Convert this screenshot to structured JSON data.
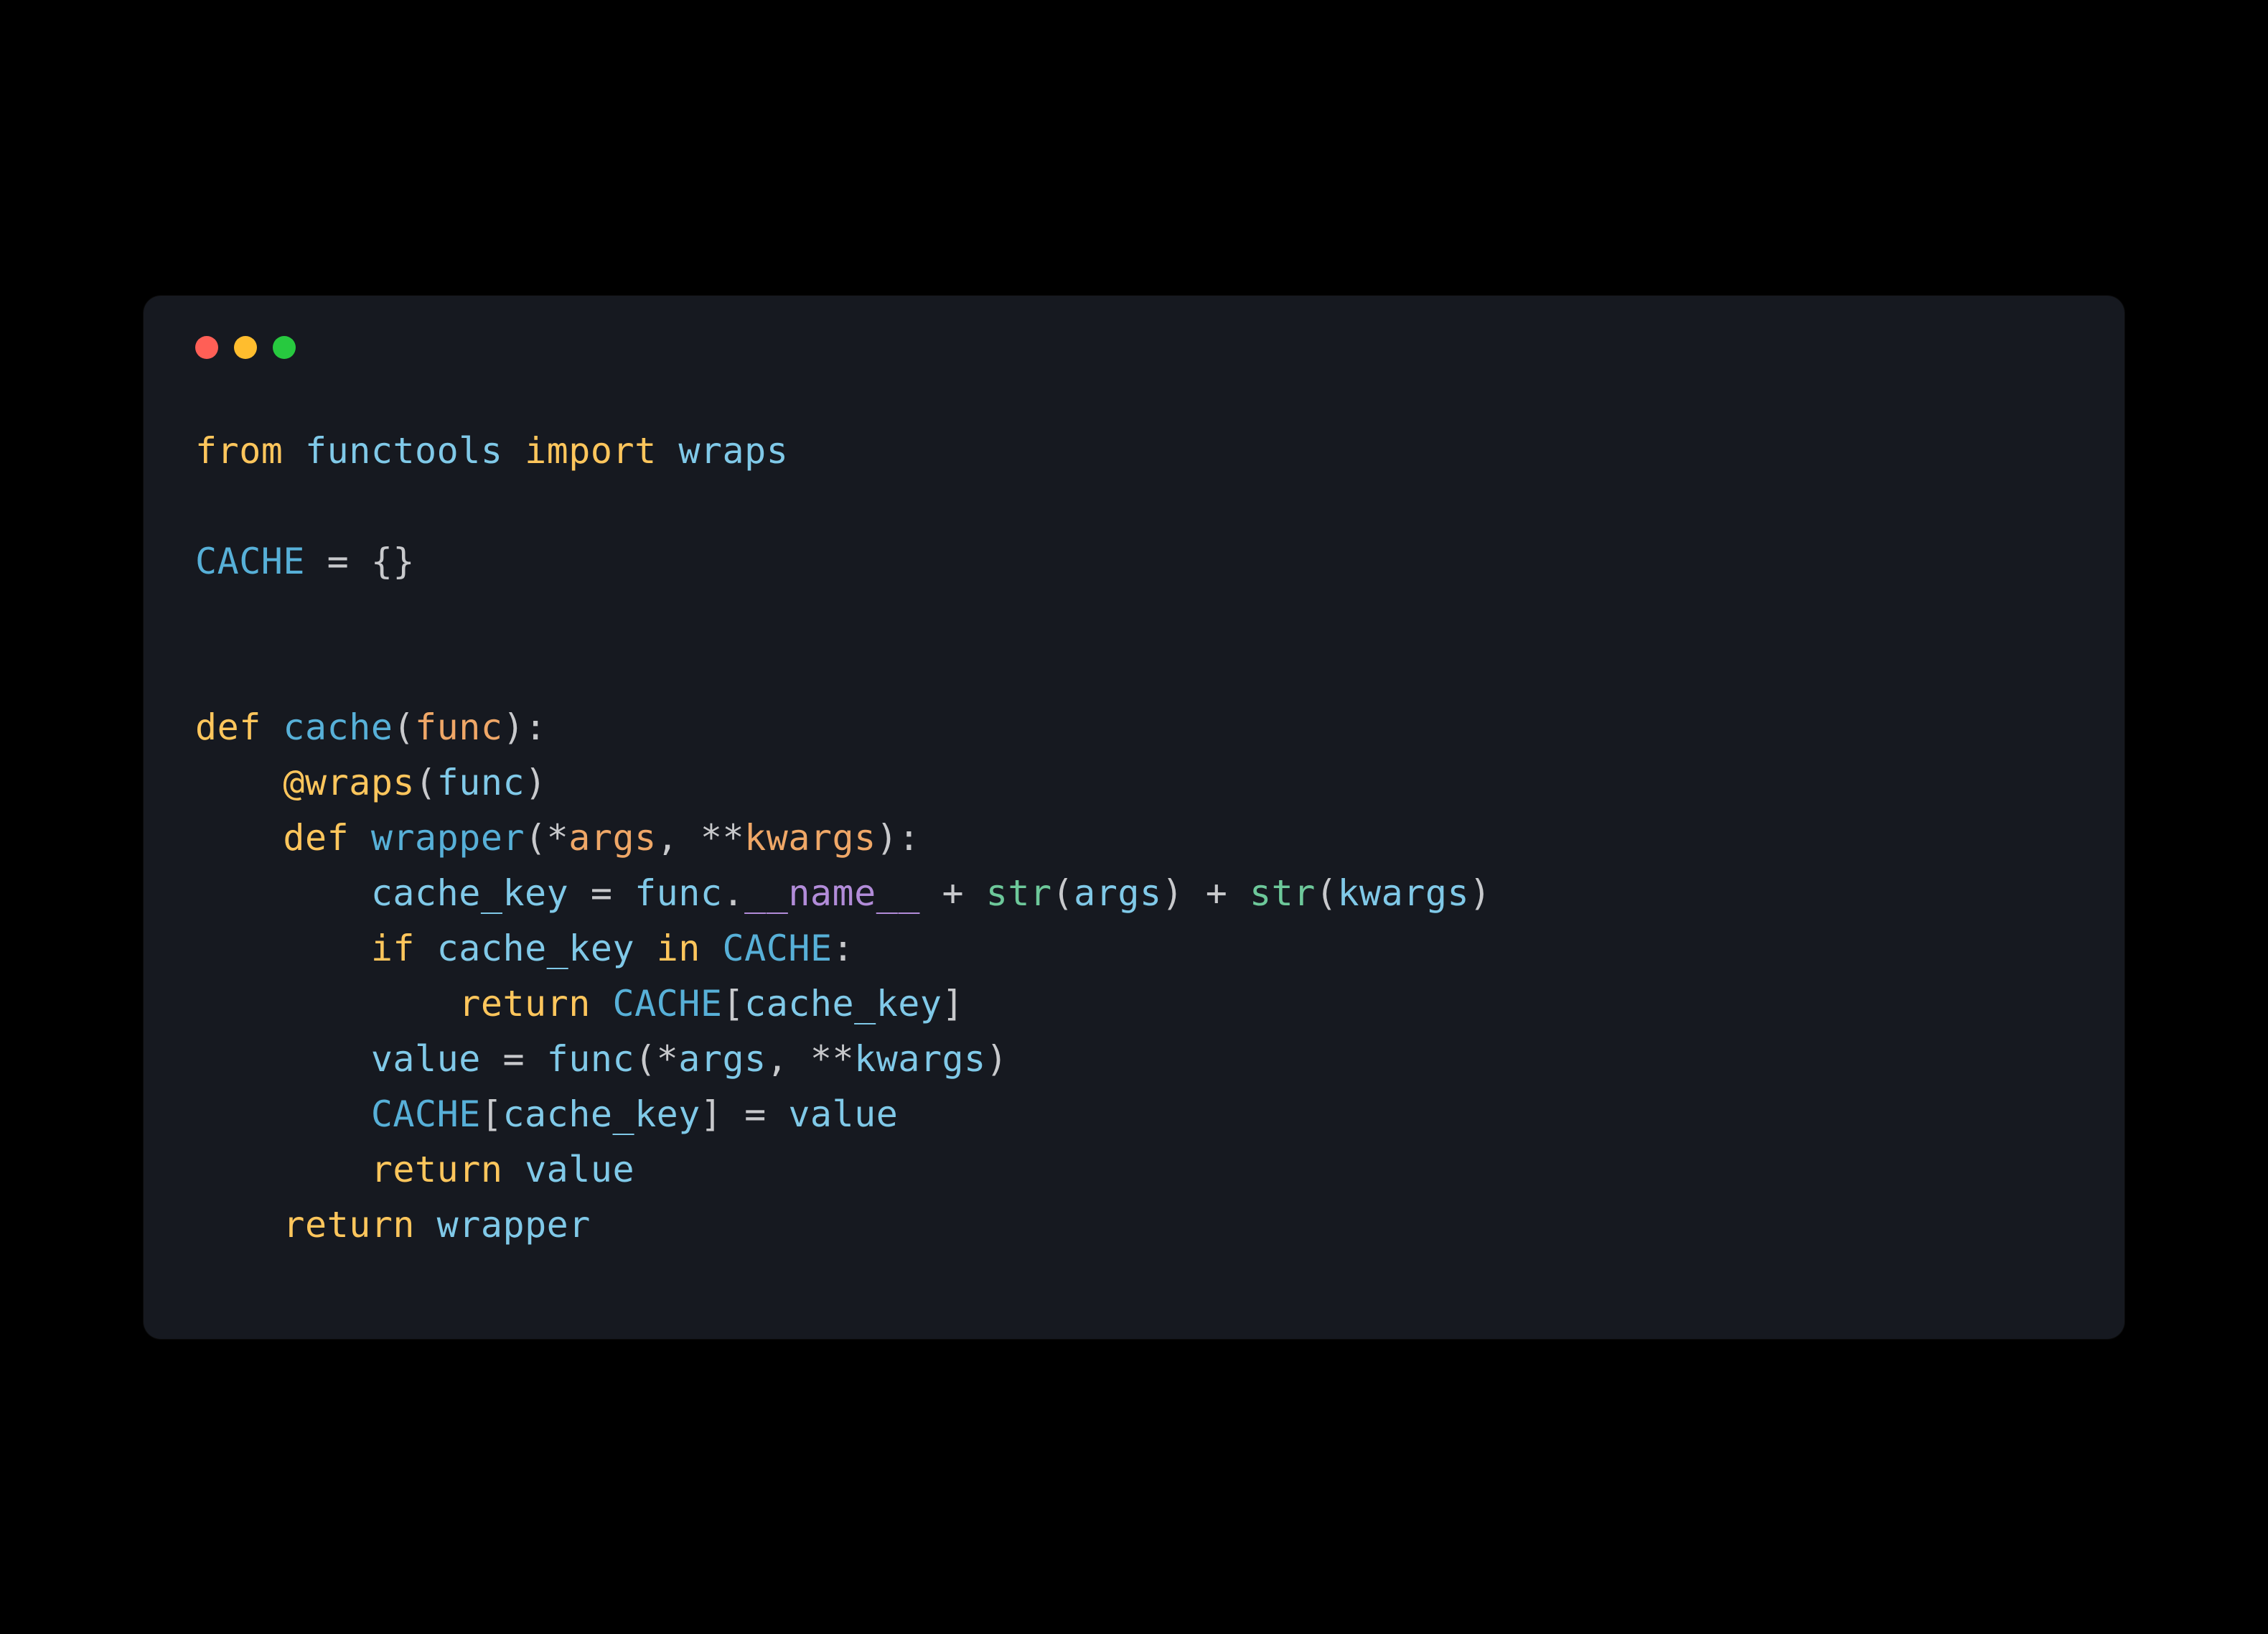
{
  "window": {
    "traffic_lights": [
      "red",
      "yellow",
      "green"
    ]
  },
  "code": {
    "lines": [
      [
        {
          "t": "from",
          "c": "k-keyword"
        },
        {
          "t": " ",
          "c": "k-punct"
        },
        {
          "t": "functools",
          "c": "k-module"
        },
        {
          "t": " ",
          "c": "k-punct"
        },
        {
          "t": "import",
          "c": "k-keyword"
        },
        {
          "t": " ",
          "c": "k-punct"
        },
        {
          "t": "wraps",
          "c": "k-module"
        }
      ],
      [],
      [
        {
          "t": "CACHE",
          "c": "k-const"
        },
        {
          "t": " = {}",
          "c": "k-punct"
        }
      ],
      [],
      [],
      [
        {
          "t": "def",
          "c": "k-keyword"
        },
        {
          "t": " ",
          "c": "k-punct"
        },
        {
          "t": "cache",
          "c": "k-const"
        },
        {
          "t": "(",
          "c": "k-punct"
        },
        {
          "t": "func",
          "c": "k-param"
        },
        {
          "t": "):",
          "c": "k-punct"
        }
      ],
      [
        {
          "t": "    ",
          "c": "k-punct"
        },
        {
          "t": "@wraps",
          "c": "k-decorator"
        },
        {
          "t": "(",
          "c": "k-punct"
        },
        {
          "t": "func",
          "c": "k-module"
        },
        {
          "t": ")",
          "c": "k-punct"
        }
      ],
      [
        {
          "t": "    ",
          "c": "k-punct"
        },
        {
          "t": "def",
          "c": "k-keyword"
        },
        {
          "t": " ",
          "c": "k-punct"
        },
        {
          "t": "wrapper",
          "c": "k-const"
        },
        {
          "t": "(*",
          "c": "k-punct"
        },
        {
          "t": "args",
          "c": "k-param"
        },
        {
          "t": ", **",
          "c": "k-punct"
        },
        {
          "t": "kwargs",
          "c": "k-param"
        },
        {
          "t": "):",
          "c": "k-punct"
        }
      ],
      [
        {
          "t": "        ",
          "c": "k-punct"
        },
        {
          "t": "cache_key",
          "c": "k-module"
        },
        {
          "t": " = ",
          "c": "k-punct"
        },
        {
          "t": "func",
          "c": "k-module"
        },
        {
          "t": ".",
          "c": "k-punct"
        },
        {
          "t": "__name__",
          "c": "k-dunder"
        },
        {
          "t": " + ",
          "c": "k-punct"
        },
        {
          "t": "str",
          "c": "k-call"
        },
        {
          "t": "(",
          "c": "k-punct"
        },
        {
          "t": "args",
          "c": "k-module"
        },
        {
          "t": ") + ",
          "c": "k-punct"
        },
        {
          "t": "str",
          "c": "k-call"
        },
        {
          "t": "(",
          "c": "k-punct"
        },
        {
          "t": "kwargs",
          "c": "k-module"
        },
        {
          "t": ")",
          "c": "k-punct"
        }
      ],
      [
        {
          "t": "        ",
          "c": "k-punct"
        },
        {
          "t": "if",
          "c": "k-keyword"
        },
        {
          "t": " ",
          "c": "k-punct"
        },
        {
          "t": "cache_key",
          "c": "k-module"
        },
        {
          "t": " ",
          "c": "k-punct"
        },
        {
          "t": "in",
          "c": "k-keyword"
        },
        {
          "t": " ",
          "c": "k-punct"
        },
        {
          "t": "CACHE",
          "c": "k-const"
        },
        {
          "t": ":",
          "c": "k-punct"
        }
      ],
      [
        {
          "t": "            ",
          "c": "k-punct"
        },
        {
          "t": "return",
          "c": "k-keyword"
        },
        {
          "t": " ",
          "c": "k-punct"
        },
        {
          "t": "CACHE",
          "c": "k-const"
        },
        {
          "t": "[",
          "c": "k-punct"
        },
        {
          "t": "cache_key",
          "c": "k-module"
        },
        {
          "t": "]",
          "c": "k-punct"
        }
      ],
      [
        {
          "t": "        ",
          "c": "k-punct"
        },
        {
          "t": "value",
          "c": "k-module"
        },
        {
          "t": " = ",
          "c": "k-punct"
        },
        {
          "t": "func",
          "c": "k-module"
        },
        {
          "t": "(*",
          "c": "k-punct"
        },
        {
          "t": "args",
          "c": "k-module"
        },
        {
          "t": ", **",
          "c": "k-punct"
        },
        {
          "t": "kwargs",
          "c": "k-module"
        },
        {
          "t": ")",
          "c": "k-punct"
        }
      ],
      [
        {
          "t": "        ",
          "c": "k-punct"
        },
        {
          "t": "CACHE",
          "c": "k-const"
        },
        {
          "t": "[",
          "c": "k-punct"
        },
        {
          "t": "cache_key",
          "c": "k-module"
        },
        {
          "t": "] = ",
          "c": "k-punct"
        },
        {
          "t": "value",
          "c": "k-module"
        }
      ],
      [
        {
          "t": "        ",
          "c": "k-punct"
        },
        {
          "t": "return",
          "c": "k-keyword"
        },
        {
          "t": " ",
          "c": "k-punct"
        },
        {
          "t": "value",
          "c": "k-module"
        }
      ],
      [
        {
          "t": "    ",
          "c": "k-punct"
        },
        {
          "t": "return",
          "c": "k-keyword"
        },
        {
          "t": " ",
          "c": "k-punct"
        },
        {
          "t": "wrapper",
          "c": "k-module"
        }
      ]
    ]
  }
}
